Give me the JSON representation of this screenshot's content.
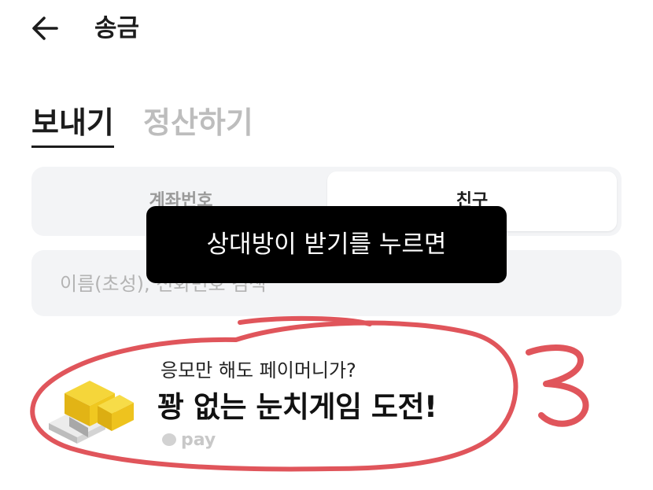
{
  "header": {
    "title": "송금",
    "back_icon": "arrow-left-icon"
  },
  "tabs": [
    {
      "label": "보내기",
      "active": true
    },
    {
      "label": "정산하기",
      "active": false
    }
  ],
  "segment": {
    "account_label": "계좌번호",
    "friend_label": "친구",
    "selected": "친구"
  },
  "search": {
    "placeholder": "이름(초성), 전화번호 검색",
    "value": ""
  },
  "toast": {
    "text": "상대방이 받기를 누르면"
  },
  "banner": {
    "subtitle": "응모만 해도 페이머니가?",
    "headline": "꽝 없는 눈치게임 도전!",
    "brand": "pay",
    "icon": "gold-box-icon"
  },
  "annotation": {
    "mark": "3",
    "color": "#e0555b"
  },
  "colors": {
    "accent_text": "#1c1c1c",
    "muted": "#bdbdbd",
    "field_bg": "#f3f4f6",
    "toast_bg": "#000000"
  }
}
